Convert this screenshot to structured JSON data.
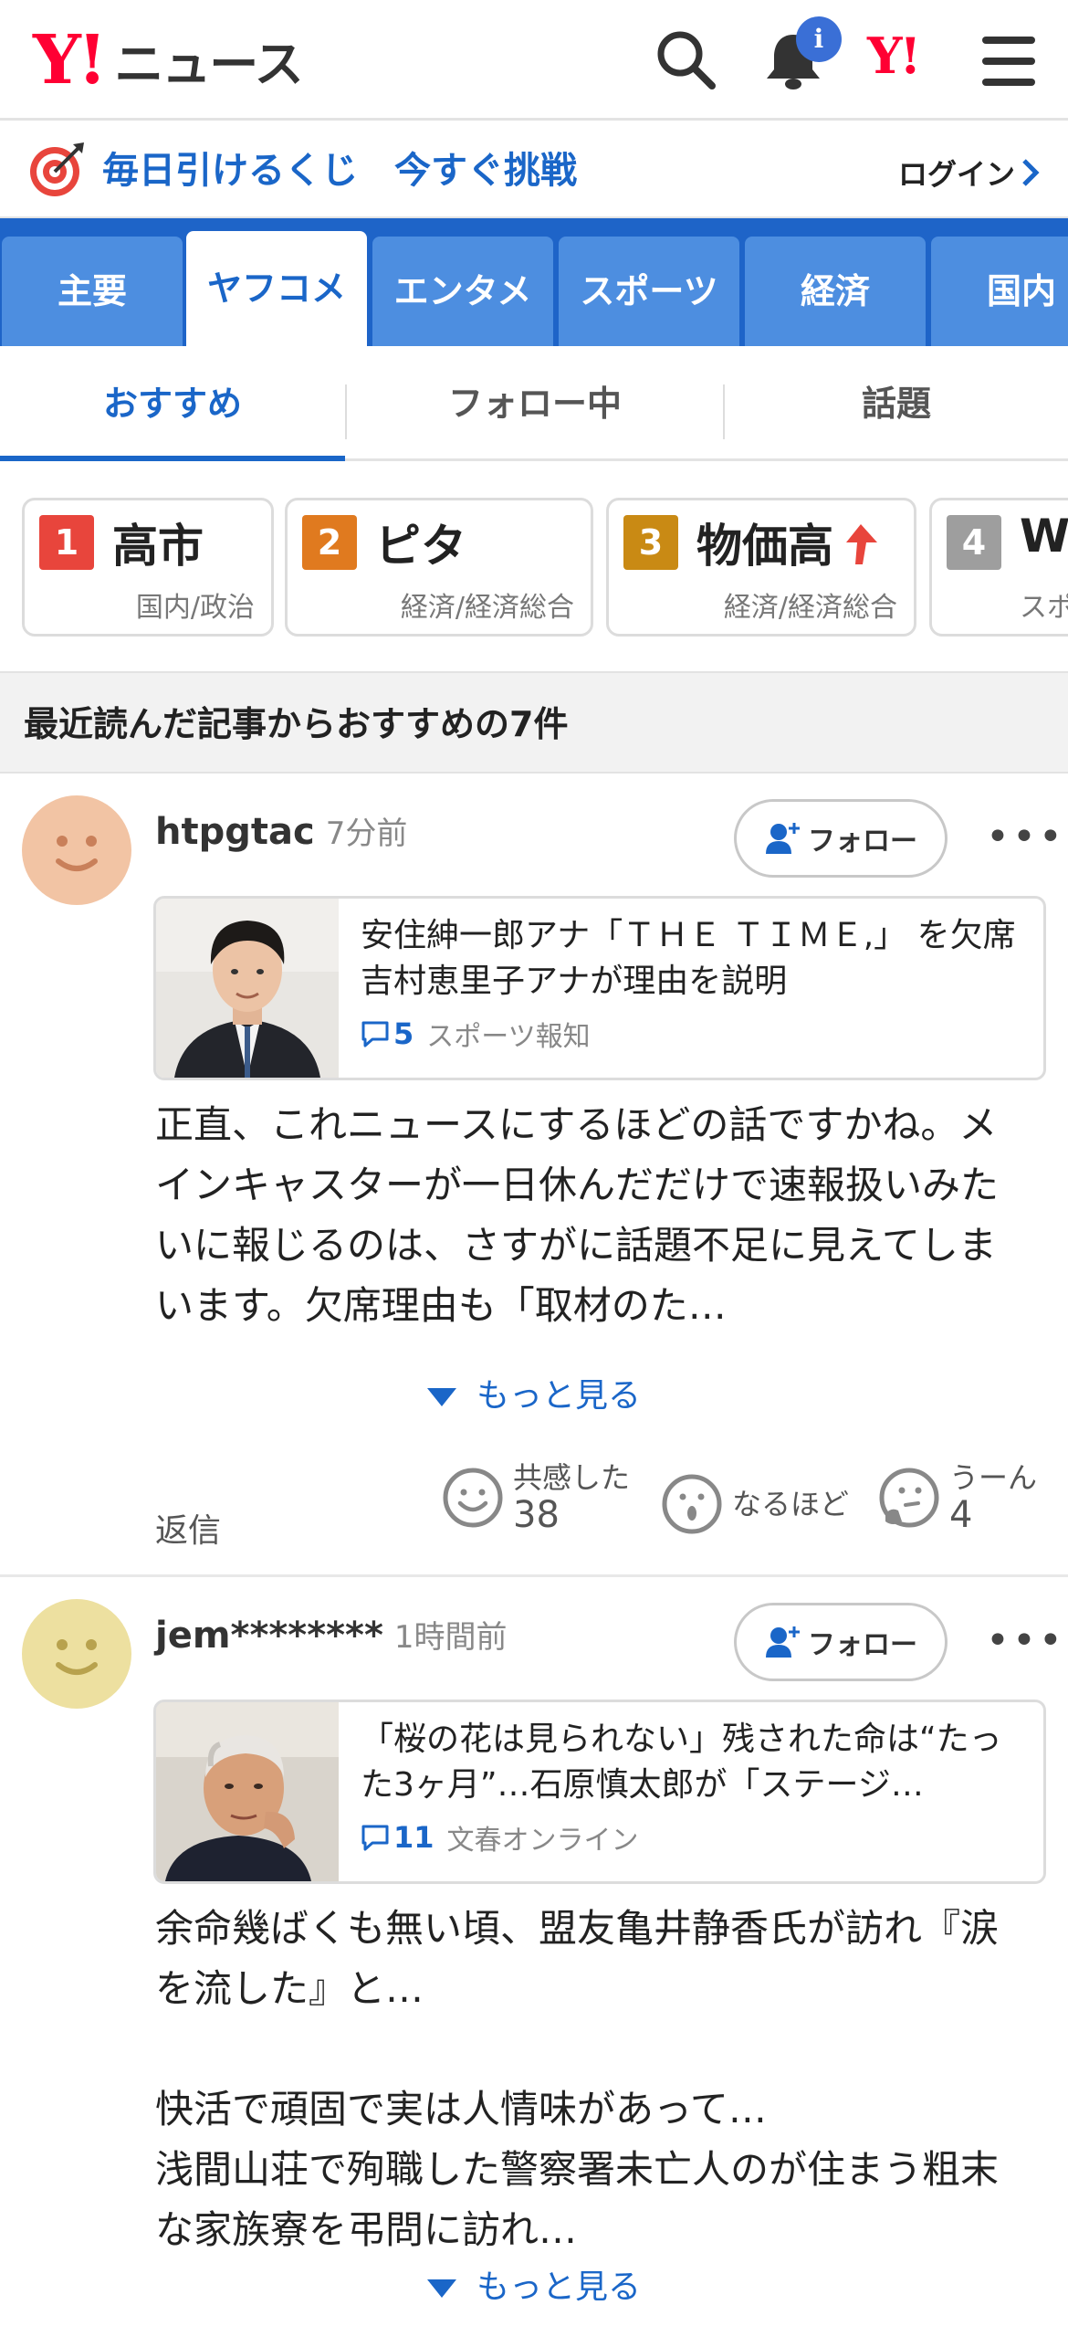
{
  "header": {
    "logo_mark": "Y!",
    "logo_text": "ニュース",
    "notification_badge": "i",
    "yahoo_mark": "Y!"
  },
  "lottery": {
    "text": "毎日引けるくじ　今すぐ挑戦",
    "login": "ログイン"
  },
  "category_tabs": [
    {
      "label": "主要"
    },
    {
      "label": "ヤフコメ"
    },
    {
      "label": "エンタメ"
    },
    {
      "label": "スポーツ"
    },
    {
      "label": "経済"
    },
    {
      "label": "国内"
    }
  ],
  "sub_tabs": [
    {
      "label": "おすすめ"
    },
    {
      "label": "フォロー中"
    },
    {
      "label": "話題"
    }
  ],
  "trending": [
    {
      "rank": "1",
      "word": "高市",
      "category": "国内/政治",
      "color": "#e8453c"
    },
    {
      "rank": "2",
      "word": "ピタ",
      "category": "経済/経済総合",
      "color": "#e07a1f"
    },
    {
      "rank": "3",
      "word": "物価高",
      "category": "経済/経済総合",
      "color": "#c98a14"
    },
    {
      "rank": "4",
      "word": "W",
      "category": "スポ",
      "color": "#9e9e9e"
    }
  ],
  "section_heading": "最近読んだ記事からおすすめの7件",
  "comments": [
    {
      "user": "htpgtac",
      "time": "7分前",
      "follow": "フォロー",
      "more": "•••",
      "avatar_color": "#f2c4a4",
      "article_title": "安住紳一郎アナ「ＴＨＥ ＴＩＭＥ,」 を欠席　吉村恵里子アナが理由を説明",
      "article_comments": "5",
      "article_source": "スポーツ報知",
      "body": "正直、これニュースにするほどの話ですかね。メインキャスターが一日休んだだけで速報扱いみたいに報じるのは、さすがに話題不足に見えてしまいます。欠席理由も「取材のた…",
      "show_more": "もっと見る",
      "reply": "返信",
      "reactions": [
        {
          "label": "共感した",
          "count": "38"
        },
        {
          "label": "なるほど",
          "count": ""
        },
        {
          "label": "うーん",
          "count": "4"
        }
      ]
    },
    {
      "user": "jem********",
      "time": "1時間前",
      "follow": "フォロー",
      "more": "•••",
      "avatar_color": "#ede0a0",
      "article_title": "「桜の花は見られない」残された命は“たった3ヶ月”…石原慎太郎が「ステージ…",
      "article_comments": "11",
      "article_source": "文春オンライン",
      "body": "余命幾ばくも無い頃、盟友亀井静香氏が訪れ『涙を流した』と…\n\n快活で頑固で実は人情味があって…\n浅間山荘で殉職した警察署未亡人のが住まう粗末な家族寮を弔問に訪れ…",
      "show_more": "もっと見る"
    }
  ]
}
